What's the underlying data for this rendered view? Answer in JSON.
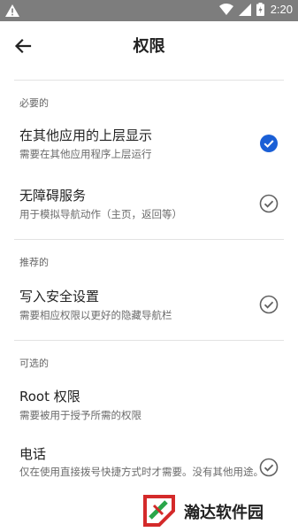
{
  "status_bar": {
    "time": "2:20",
    "warning_icon": "warning-icon",
    "wifi_icon": "wifi-icon",
    "battery_icon": "battery-icon"
  },
  "app_bar": {
    "title": "权限",
    "back_icon": "arrow-back-icon"
  },
  "sections": [
    {
      "label": "必要的",
      "items": [
        {
          "title": "在其他应用的上层显示",
          "subtitle": "需要在其他应用程序上层运行",
          "checked": true
        },
        {
          "title": "无障碍服务",
          "subtitle": "用于模拟导航动作（主页，返回等）",
          "checked": false
        }
      ]
    },
    {
      "label": "推荐的",
      "items": [
        {
          "title": "写入安全设置",
          "subtitle": "需要相应权限以更好的隐藏导航栏",
          "checked": false
        }
      ]
    },
    {
      "label": "可选的",
      "items": [
        {
          "title": "Root 权限",
          "subtitle": "需要被用于授予所需的权限",
          "checked": null
        },
        {
          "title": "电话",
          "subtitle": "仅在使用直接拨号快捷方式时才需要。没有其他用途。",
          "checked": false
        }
      ]
    }
  ],
  "watermark": {
    "text": "瀚达软件园"
  },
  "colors": {
    "accent": "#1a5fd6",
    "status_bar": "#7d7d7d",
    "check_outline": "#616161"
  }
}
